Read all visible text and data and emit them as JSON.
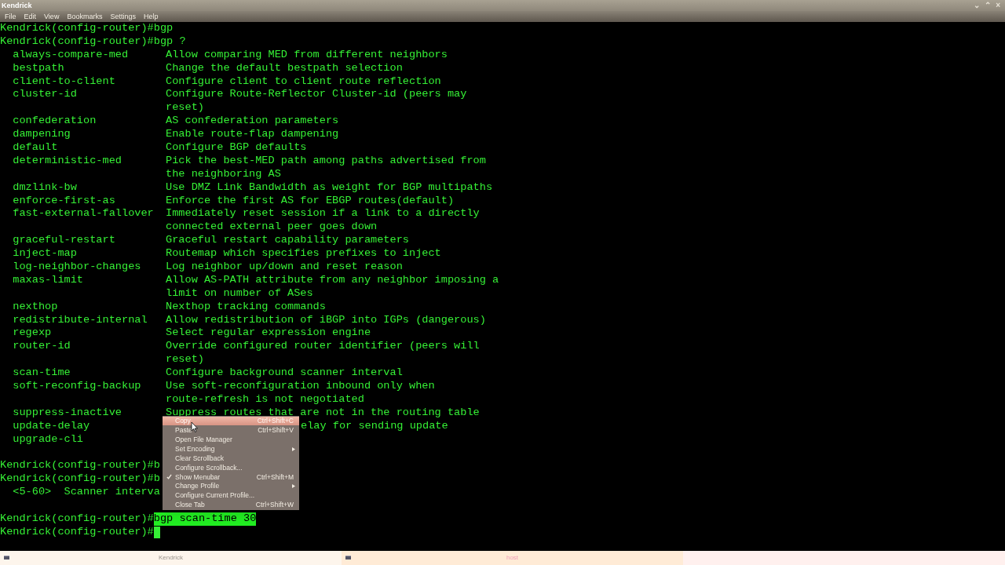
{
  "window": {
    "title": "Kendrick",
    "controls": [
      "⌄",
      "⌃",
      "×"
    ]
  },
  "menubar": [
    "File",
    "Edit",
    "View",
    "Bookmarks",
    "Settings",
    "Help"
  ],
  "terminal": {
    "lines": [
      {
        "kind": "prompt",
        "prompt": "Kendrick(config-router)#",
        "command": "bgp"
      },
      {
        "kind": "prompt",
        "prompt": "Kendrick(config-router)#",
        "command": "bgp ?"
      },
      {
        "kind": "help",
        "name": "always-compare-med",
        "desc": [
          "Allow comparing MED from different neighbors"
        ]
      },
      {
        "kind": "help",
        "name": "bestpath",
        "desc": [
          "Change the default bestpath selection"
        ]
      },
      {
        "kind": "help",
        "name": "client-to-client",
        "desc": [
          "Configure client to client route reflection"
        ]
      },
      {
        "kind": "help",
        "name": "cluster-id",
        "desc": [
          "Configure Route-Reflector Cluster-id (peers may",
          "reset)"
        ]
      },
      {
        "kind": "help",
        "name": "confederation",
        "desc": [
          "AS confederation parameters"
        ]
      },
      {
        "kind": "help",
        "name": "dampening",
        "desc": [
          "Enable route-flap dampening"
        ]
      },
      {
        "kind": "help",
        "name": "default",
        "desc": [
          "Configure BGP defaults"
        ]
      },
      {
        "kind": "help",
        "name": "deterministic-med",
        "desc": [
          "Pick the best-MED path among paths advertised from",
          "the neighboring AS"
        ]
      },
      {
        "kind": "help",
        "name": "dmzlink-bw",
        "desc": [
          "Use DMZ Link Bandwidth as weight for BGP multipaths"
        ]
      },
      {
        "kind": "help",
        "name": "enforce-first-as",
        "desc": [
          "Enforce the first AS for EBGP routes(default)"
        ]
      },
      {
        "kind": "help",
        "name": "fast-external-fallover",
        "desc": [
          "Immediately reset session if a link to a directly",
          "connected external peer goes down"
        ]
      },
      {
        "kind": "help",
        "name": "graceful-restart",
        "desc": [
          "Graceful restart capability parameters"
        ]
      },
      {
        "kind": "help",
        "name": "inject-map",
        "desc": [
          "Routemap which specifies prefixes to inject"
        ]
      },
      {
        "kind": "help",
        "name": "log-neighbor-changes",
        "desc": [
          "Log neighbor up/down and reset reason"
        ]
      },
      {
        "kind": "help",
        "name": "maxas-limit",
        "desc": [
          "Allow AS-PATH attribute from any neighbor imposing a",
          "limit on number of ASes"
        ]
      },
      {
        "kind": "help",
        "name": "nexthop",
        "desc": [
          "Nexthop tracking commands"
        ]
      },
      {
        "kind": "help",
        "name": "redistribute-internal",
        "desc": [
          "Allow redistribution of iBGP into IGPs (dangerous)"
        ]
      },
      {
        "kind": "help",
        "name": "regexp",
        "desc": [
          "Select regular expression engine"
        ]
      },
      {
        "kind": "help",
        "name": "router-id",
        "desc": [
          "Override configured router identifier (peers will",
          "reset)"
        ]
      },
      {
        "kind": "help",
        "name": "scan-time",
        "desc": [
          "Configure background scanner interval"
        ]
      },
      {
        "kind": "help",
        "name": "soft-reconfig-backup",
        "desc": [
          "Use soft-reconfiguration inbound only when",
          "route-refresh is not negotiated"
        ]
      },
      {
        "kind": "help",
        "name": "suppress-inactive",
        "desc": [
          "Suppress routes that are not in the routing table"
        ]
      },
      {
        "kind": "split",
        "name": "update-delay",
        "right": "elay for sending update"
      },
      {
        "kind": "help",
        "name": "upgrade-cli"
      },
      {
        "kind": "blank"
      },
      {
        "kind": "prompt",
        "prompt": "Kendrick(config-router)#",
        "command": "b"
      },
      {
        "kind": "prompt",
        "prompt": "Kendrick(config-router)#",
        "command": "b"
      },
      {
        "kind": "output",
        "text": "<5-60>  Scanner interva"
      },
      {
        "kind": "blank"
      },
      {
        "kind": "prompt",
        "prompt": "Kendrick(config-router)#",
        "command": "bgp scan-time 30",
        "selected": true
      },
      {
        "kind": "prompt",
        "prompt": "Kendrick(config-router)#",
        "cursor": true
      }
    ]
  },
  "context_menu": [
    {
      "label": "Copy",
      "shortcut": "Ctrl+Shift+C",
      "selected": true
    },
    {
      "label": "Paste",
      "shortcut": "Ctrl+Shift+V",
      "selected": false
    },
    {
      "label": "Open File Manager",
      "selected": false
    },
    {
      "label": "Set Encoding",
      "submenu": true,
      "selected": false
    },
    {
      "label": "Clear Scrollback",
      "selected": false
    },
    {
      "label": "Configure Scrollback...",
      "selected": false
    },
    {
      "label": "Show Menubar",
      "shortcut": "Ctrl+Shift+M",
      "checked": true,
      "selected": false
    },
    {
      "label": "Change Profile",
      "submenu": true,
      "selected": false
    },
    {
      "label": "Configure Current Profile...",
      "selected": false
    },
    {
      "label": "Close Tab",
      "shortcut": "Ctrl+Shift+W",
      "selected": false
    }
  ],
  "tabs": [
    {
      "label": "Kendrick",
      "selected": true
    },
    {
      "label": "host",
      "selected": false
    }
  ]
}
